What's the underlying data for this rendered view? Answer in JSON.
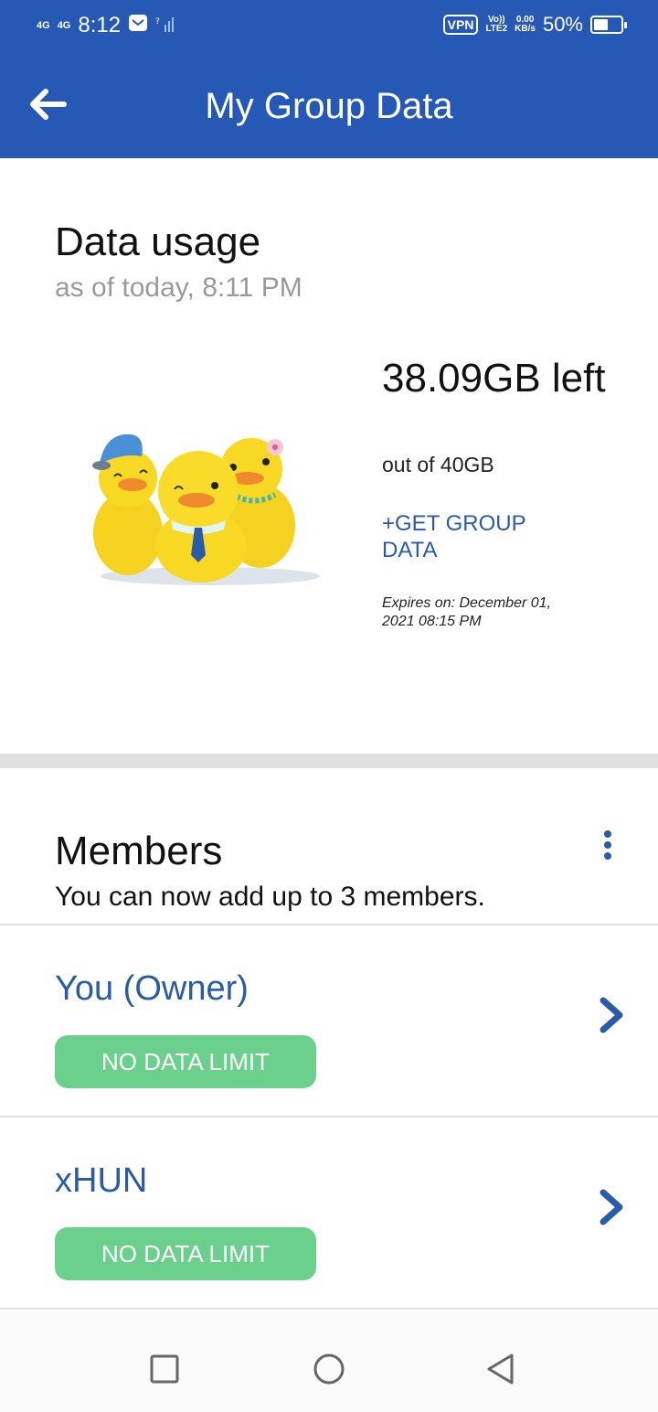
{
  "status_bar": {
    "signal1": "4G",
    "signal2": "4G",
    "time": "8:12",
    "vpn": "VPN",
    "volte_top": "Vo))",
    "volte_bottom": "LTE2",
    "speed_top": "0.00",
    "speed_bottom": "KB/s",
    "battery": "50%"
  },
  "app_bar": {
    "title": "My Group Data",
    "back_icon": "arrow-left-icon"
  },
  "usage": {
    "title": "Data usage",
    "subtitle": "as of today, 8:11 PM",
    "remaining": "38.09GB left",
    "total": "out of 40GB",
    "get_data": "+GET GROUP DATA",
    "expires": "Expires on: December 01, 2021 08:15 PM"
  },
  "members": {
    "title": "Members",
    "subtitle": "You can now add up to 3 members.",
    "list": [
      {
        "name": "You (Owner)",
        "badge": "NO DATA LIMIT"
      },
      {
        "name": "xHUN",
        "badge": "NO DATA LIMIT"
      }
    ]
  },
  "colors": {
    "primary": "#2658b5",
    "link": "#2a5ba8",
    "badge": "#6cd08d",
    "divider": "#e0e0e0"
  }
}
